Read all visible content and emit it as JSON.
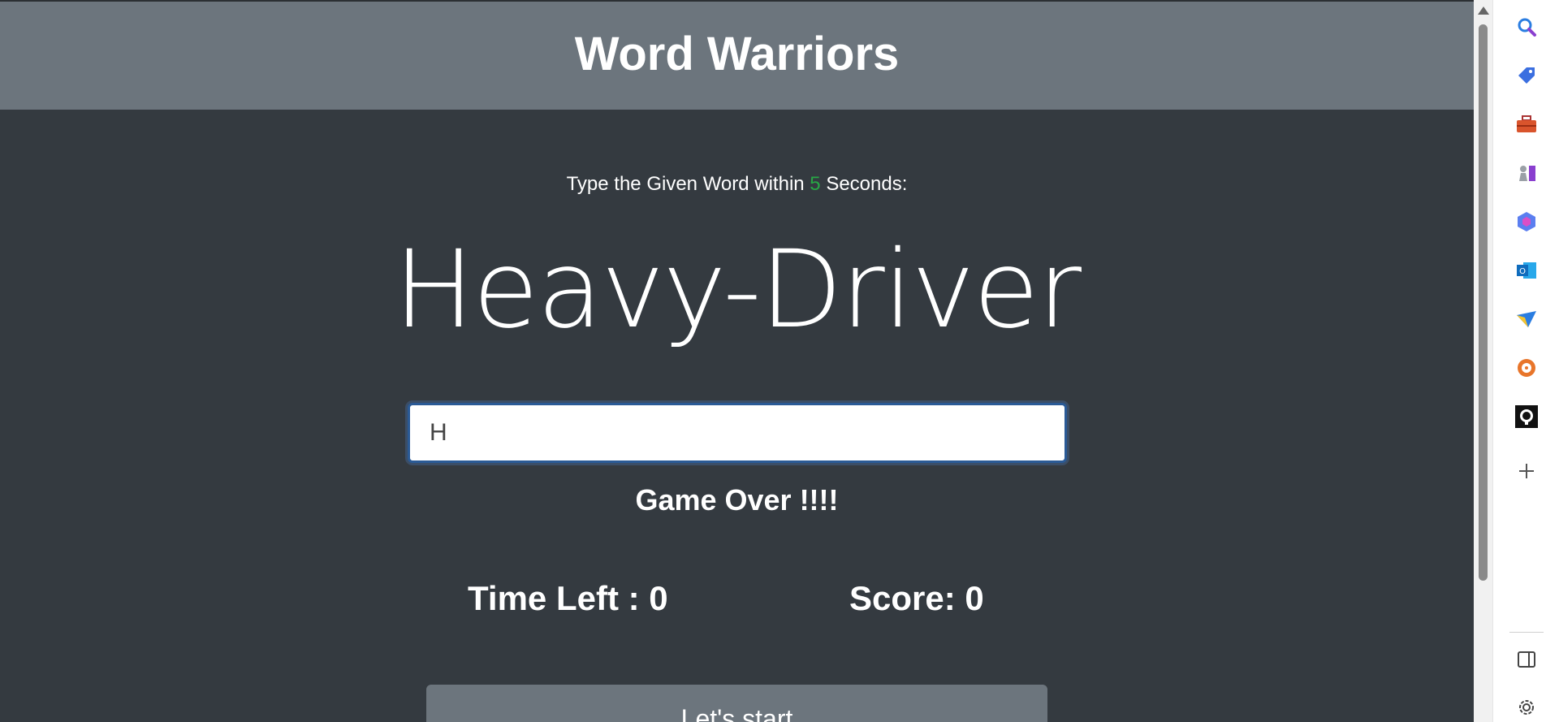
{
  "app": {
    "title": "Word Warriors"
  },
  "instruction": {
    "prefix": "Type the Given Word within",
    "seconds": "5",
    "suffix": "Seconds:"
  },
  "current_word": "Heavy-Driver",
  "input": {
    "value": "H",
    "placeholder": ""
  },
  "status_message": "Game Over !!!!",
  "stats": {
    "time_left": "Time Left : 0",
    "score": "Score: 0"
  },
  "start_button": {
    "label": "Let's start"
  },
  "sidebar": {
    "icons": [
      "search-icon",
      "tag-icon",
      "toolbox-icon",
      "games-icon",
      "copilot-icon",
      "outlook-icon",
      "send-icon",
      "compass-icon",
      "github-icon",
      "add-icon",
      "sidebar-toggle-icon",
      "settings-icon"
    ]
  },
  "colors": {
    "header_bg": "#6c757d",
    "page_bg": "#343a40",
    "seconds_accent": "#28a745",
    "input_border": "#2a5a96"
  }
}
